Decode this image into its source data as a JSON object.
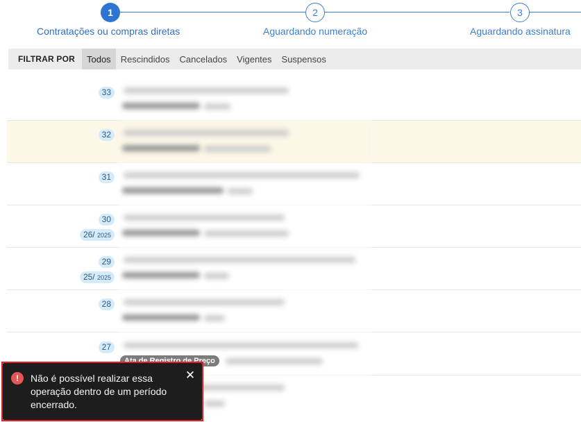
{
  "stepper": {
    "steps": [
      {
        "number": "1",
        "label": "Contratações ou compras diretas",
        "state": "active"
      },
      {
        "number": "2",
        "label": "Aguardando numeração",
        "state": "inactive"
      },
      {
        "number": "3",
        "label": "Aguardando assinatura",
        "state": "inactive"
      }
    ]
  },
  "filter": {
    "title": "FILTRAR POR",
    "options": [
      "Todos",
      "Rescindidos",
      "Cancelados",
      "Vigentes",
      "Suspensos"
    ],
    "selected": "Todos"
  },
  "list": {
    "rows": [
      {
        "number": "33",
        "sub": "",
        "sub_year": ""
      },
      {
        "number": "32",
        "sub": "",
        "sub_year": ""
      },
      {
        "number": "31",
        "sub": "",
        "sub_year": ""
      },
      {
        "number": "30",
        "sub": "26/",
        "sub_year": "2025"
      },
      {
        "number": "29",
        "sub": "25/",
        "sub_year": "2025"
      },
      {
        "number": "28",
        "sub": "",
        "sub_year": ""
      },
      {
        "number": "27",
        "sub": "",
        "sub_year": "",
        "tag": "Ata de Registro de Preço"
      }
    ]
  },
  "toast": {
    "icon": "error-icon",
    "message": "Não é possível realizar essa operação dentro de um período encerrado.",
    "close_icon": "close-icon",
    "color": "#1d1d1d",
    "accent": "#e45555"
  }
}
